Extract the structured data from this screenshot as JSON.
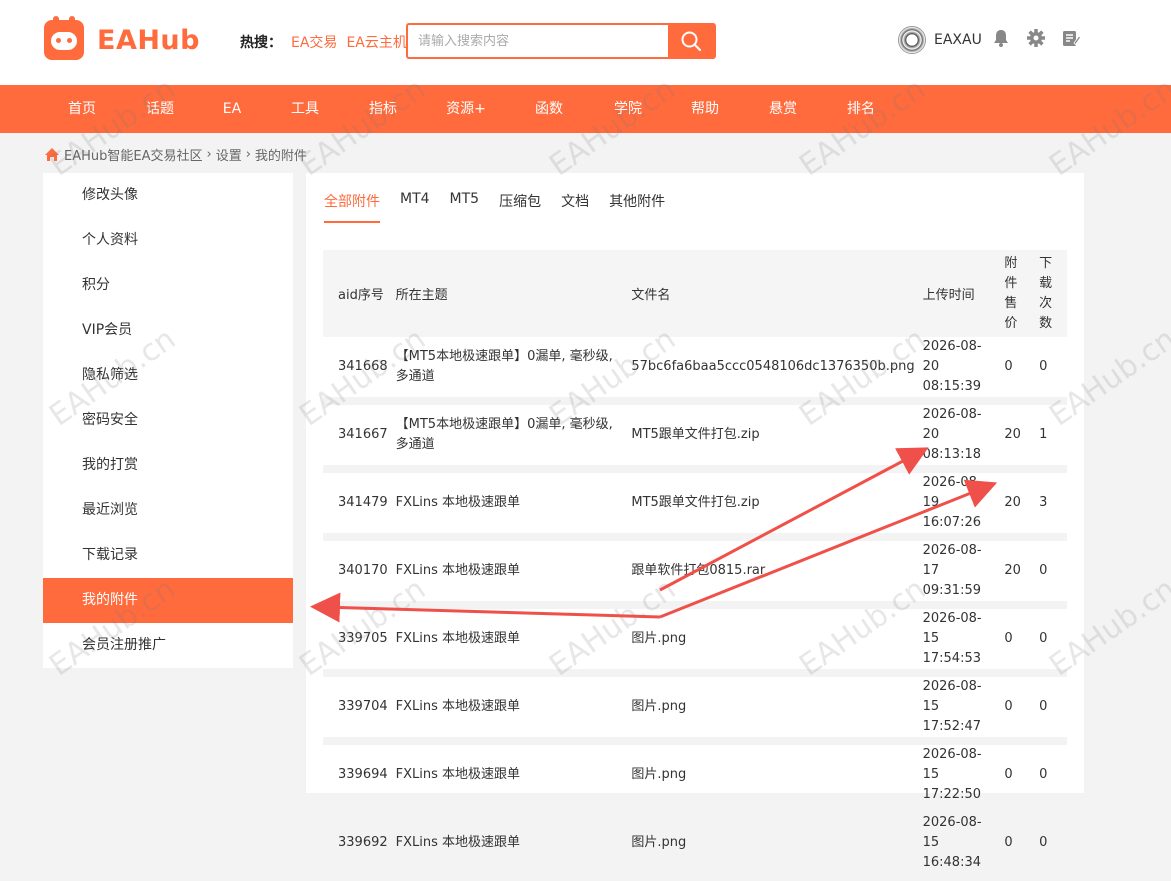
{
  "header": {
    "logo_text": "EAHub",
    "hot_label": "热搜：",
    "hot_links": [
      "EA交易",
      "EA云主机"
    ],
    "search_placeholder": "请输入搜索内容",
    "username": "EAXAU"
  },
  "nav": {
    "items": [
      "首页",
      "话题",
      "EA",
      "工具",
      "指标",
      "资源+",
      "函数",
      "学院",
      "帮助",
      "悬赏",
      "排名"
    ]
  },
  "breadcrumb": {
    "home": "EAHub智能EA交易社区",
    "sep": "›",
    "level1": "设置",
    "level2": "我的附件"
  },
  "sidebar": {
    "items": [
      "修改头像",
      "个人资料",
      "积分",
      "VIP会员",
      "隐私筛选",
      "密码安全",
      "我的打赏",
      "最近浏览",
      "下载记录",
      "我的附件",
      "会员注册推广"
    ],
    "active_index": 9
  },
  "tabs": {
    "items": [
      "全部附件",
      "MT4",
      "MT5",
      "压缩包",
      "文档",
      "其他附件"
    ],
    "active_index": 0
  },
  "table": {
    "headers": {
      "aid": "aid序号",
      "topic": "所在主题",
      "filename": "文件名",
      "upload_time": "上传时间",
      "price": "附件售价",
      "downloads": "下载次数"
    },
    "rows": [
      {
        "aid": "341668",
        "topic": "【MT5本地极速跟单】0漏单, 毫秒级,多通道",
        "filename": "57bc6fa6baa5ccc0548106dc1376350b.png",
        "date": "2026-08-20",
        "time": "08:15:39",
        "price": "0",
        "downloads": "0"
      },
      {
        "aid": "341667",
        "topic": "【MT5本地极速跟单】0漏单, 毫秒级,多通道",
        "filename": "MT5跟单文件打包.zip",
        "date": "2026-08-20",
        "time": "08:13:18",
        "price": "20",
        "downloads": "1"
      },
      {
        "aid": "341479",
        "topic": "FXLins 本地极速跟单",
        "filename": "MT5跟单文件打包.zip",
        "date": "2026-08-19",
        "time": "16:07:26",
        "price": "20",
        "downloads": "3"
      },
      {
        "aid": "340170",
        "topic": "FXLins 本地极速跟单",
        "filename": "跟单软件打包0815.rar",
        "date": "2026-08-17",
        "time": "09:31:59",
        "price": "20",
        "downloads": "0"
      },
      {
        "aid": "339705",
        "topic": "FXLins 本地极速跟单",
        "filename": "图片.png",
        "date": "2026-08-15",
        "time": "17:54:53",
        "price": "0",
        "downloads": "0"
      },
      {
        "aid": "339704",
        "topic": "FXLins 本地极速跟单",
        "filename": "图片.png",
        "date": "2026-08-15",
        "time": "17:52:47",
        "price": "0",
        "downloads": "0"
      },
      {
        "aid": "339694",
        "topic": "FXLins 本地极速跟单",
        "filename": "图片.png",
        "date": "2026-08-15",
        "time": "17:22:50",
        "price": "0",
        "downloads": "0"
      },
      {
        "aid": "339692",
        "topic": "FXLins 本地极速跟单",
        "filename": "图片.png",
        "date": "2026-08-15",
        "time": "16:48:34",
        "price": "0",
        "downloads": "0"
      }
    ]
  },
  "watermark": "EAHub.cn",
  "colors": {
    "accent": "#ff6b3d",
    "annotation": "#f0504a"
  }
}
